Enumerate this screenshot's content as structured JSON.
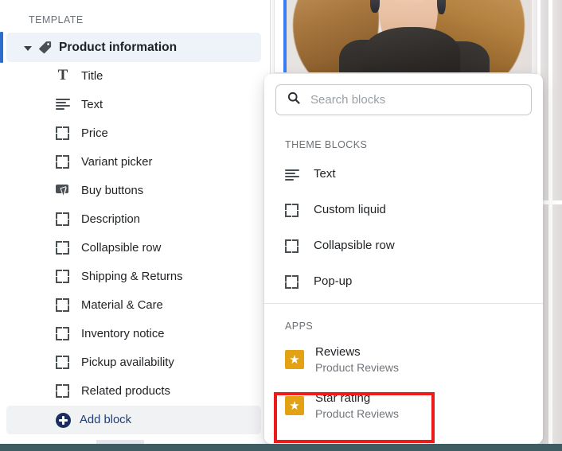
{
  "sidebar": {
    "section_label": "TEMPLATE",
    "group": {
      "label": "Product information",
      "icon": "tag-icon",
      "caret": "chevron-down-icon",
      "selected": true
    },
    "items": [
      {
        "label": "Title",
        "icon": "title-icon"
      },
      {
        "label": "Text",
        "icon": "text-lines-icon"
      },
      {
        "label": "Price",
        "icon": "block-frame-icon"
      },
      {
        "label": "Variant picker",
        "icon": "block-frame-icon"
      },
      {
        "label": "Buy buttons",
        "icon": "buy-button-cursor-icon"
      },
      {
        "label": "Description",
        "icon": "block-frame-icon"
      },
      {
        "label": "Collapsible row",
        "icon": "block-frame-icon"
      },
      {
        "label": "Shipping & Returns",
        "icon": "block-frame-icon"
      },
      {
        "label": "Material & Care",
        "icon": "block-frame-icon"
      },
      {
        "label": "Inventory notice",
        "icon": "block-frame-icon"
      },
      {
        "label": "Pickup availability",
        "icon": "block-frame-icon"
      },
      {
        "label": "Related products",
        "icon": "block-frame-icon"
      }
    ],
    "add_block": {
      "label": "Add block",
      "icon": "plus-circle-icon"
    }
  },
  "popover": {
    "search": {
      "placeholder": "Search blocks",
      "value": "",
      "icon": "search-icon"
    },
    "theme_blocks": {
      "label": "THEME BLOCKS",
      "items": [
        {
          "label": "Text",
          "icon": "text-lines-icon"
        },
        {
          "label": "Custom liquid",
          "icon": "block-frame-icon"
        },
        {
          "label": "Collapsible row",
          "icon": "block-frame-icon"
        },
        {
          "label": "Pop-up",
          "icon": "block-frame-icon"
        }
      ]
    },
    "apps": {
      "label": "APPS",
      "items": [
        {
          "title": "Reviews",
          "subtitle": "Product Reviews",
          "icon": "star-app-icon"
        },
        {
          "title": "Star rating",
          "subtitle": "Product Reviews",
          "icon": "star-app-icon"
        }
      ]
    }
  },
  "annotation": {
    "highlight_target": "Star rating",
    "color": "#ee1b1b"
  },
  "colors": {
    "selected_row_bg": "#eef2f9",
    "selection_indicator": "#2c6ecb",
    "add_block_bg": "#f1f2f4",
    "add_block_text": "#1f3e73",
    "app_icon_bg": "#e2a213",
    "bottom_bar": "#3e5c62",
    "preview_bg": "#f6f6f7",
    "preview_frame_bar": "#3b7df0"
  },
  "icons": {
    "star_glyph": "★",
    "search_glyph": "search-icon"
  }
}
